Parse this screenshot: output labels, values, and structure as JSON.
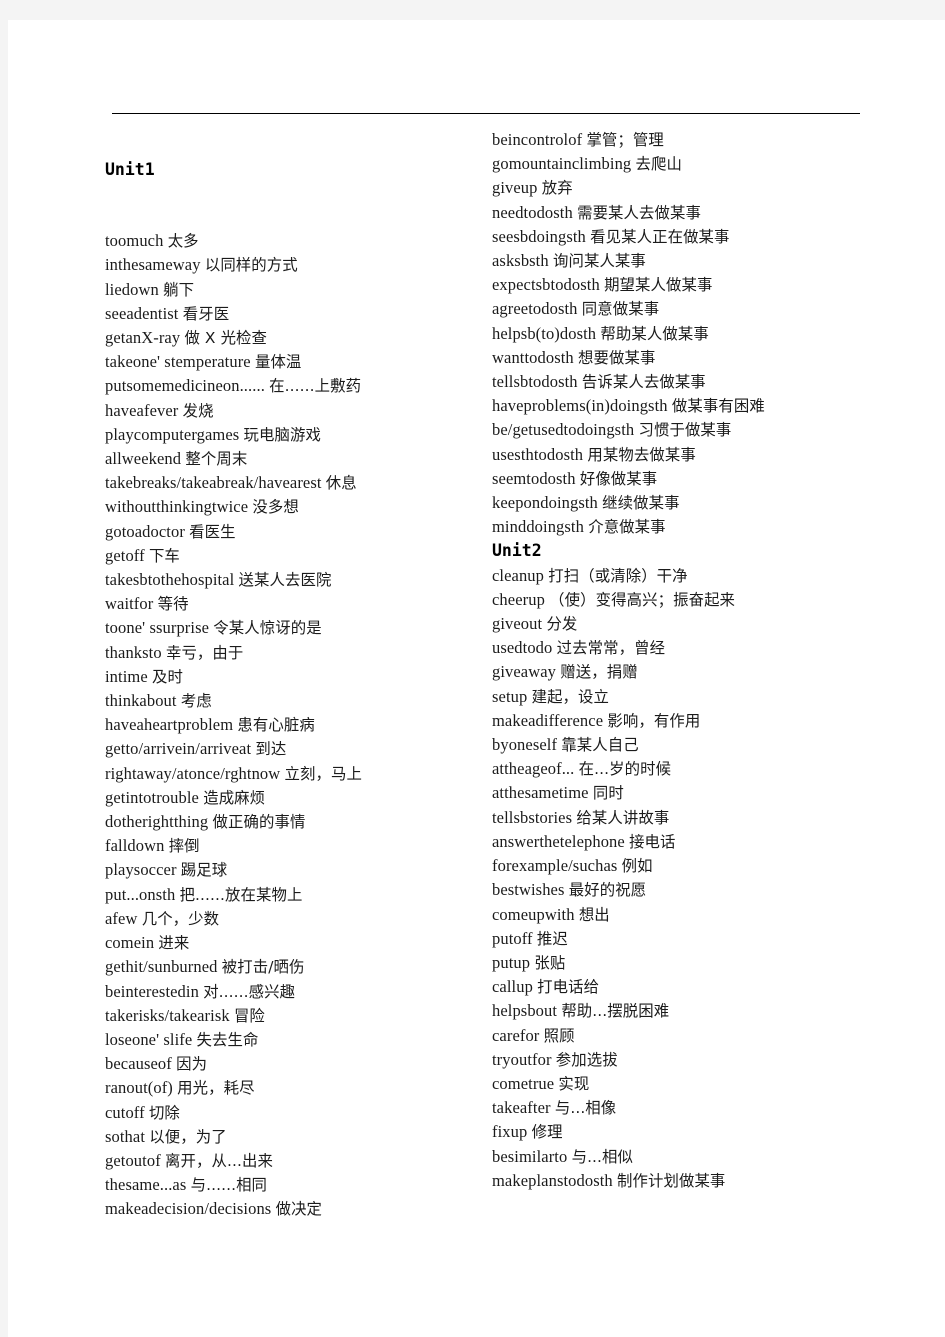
{
  "document": {
    "type": "vocabulary-list",
    "paper_color": "#ffffff",
    "background_color": "#f4f4f4",
    "rule_color": "#000000",
    "text_color": "#1b1b1b",
    "columns": 2
  },
  "left_column": {
    "heading": "Unit1",
    "entries": [
      {
        "en": "toomuch",
        "zh": "太多"
      },
      {
        "en": "inthesameway",
        "zh": "以同样的方式"
      },
      {
        "en": "liedown",
        "zh": "躺下"
      },
      {
        "en": "seeadentist",
        "zh": "看牙医"
      },
      {
        "en": "getanX-ray",
        "zh": "做 X 光检查"
      },
      {
        "en": "takeone' stemperature",
        "zh": "量体温"
      },
      {
        "en": "putsomemedicineon......",
        "zh": "在......上敷药"
      },
      {
        "en": "haveafever",
        "zh": "发烧"
      },
      {
        "en": "playcomputergames",
        "zh": "玩电脑游戏"
      },
      {
        "en": "allweekend",
        "zh": "整个周末"
      },
      {
        "en": "takebreaks/takeabreak/havearest",
        "zh": "休息"
      },
      {
        "en": "withoutthinkingtwice",
        "zh": "没多想"
      },
      {
        "en": "gotoadoctor",
        "zh": "看医生"
      },
      {
        "en": "getoff",
        "zh": "下车"
      },
      {
        "en": "takesbtothehospital",
        "zh": "送某人去医院"
      },
      {
        "en": "waitfor",
        "zh": "等待"
      },
      {
        "en": "toone' ssurprise",
        "zh": "令某人惊讶的是"
      },
      {
        "en": "thanksto",
        "zh": "幸亏，由于"
      },
      {
        "en": "intime",
        "zh": "及时"
      },
      {
        "en": "thinkabout",
        "zh": "考虑"
      },
      {
        "en": "haveaheartproblem",
        "zh": "患有心脏病"
      },
      {
        "en": "getto/arrivein/arriveat",
        "zh": "到达"
      },
      {
        "en": "rightaway/atonce/rghtnow",
        "zh": "立刻，马上"
      },
      {
        "en": "getintotrouble",
        "zh": "造成麻烦"
      },
      {
        "en": "dotherightthing",
        "zh": "做正确的事情"
      },
      {
        "en": "falldown",
        "zh": "摔倒"
      },
      {
        "en": "playsoccer",
        "zh": "踢足球"
      },
      {
        "en": "put...onsth",
        "zh": "把......放在某物上"
      },
      {
        "en": "afew",
        "zh": "几个，少数"
      },
      {
        "en": "comein",
        "zh": "进来"
      },
      {
        "en": "gethit/sunburned",
        "zh": "被打击/晒伤"
      },
      {
        "en": "beinterestedin",
        "zh": "对......感兴趣"
      },
      {
        "en": "takerisks/takearisk",
        "zh": "冒险"
      },
      {
        "en": "loseone' slife",
        "zh": "失去生命"
      },
      {
        "en": "becauseof",
        "zh": "因为"
      },
      {
        "en": "ranout(of)",
        "zh": "用光，耗尽"
      },
      {
        "en": "cutoff",
        "zh": "切除"
      },
      {
        "en": "sothat",
        "zh": "以便，为了"
      },
      {
        "en": "getoutof",
        "zh": "离开，从...出来"
      },
      {
        "en": "thesame...as",
        "zh": "与......相同"
      },
      {
        "en": "makeadecision/decisions",
        "zh": "做决定"
      }
    ]
  },
  "right_column": {
    "entries_before_unit2": [
      {
        "en": "beincontrolof",
        "zh": "掌管；管理"
      },
      {
        "en": "gomountainclimbing",
        "zh": "去爬山"
      },
      {
        "en": "giveup",
        "zh": "放弃"
      },
      {
        "en": "needtodosth",
        "zh": "需要某人去做某事"
      },
      {
        "en": "seesbdoingsth",
        "zh": "看见某人正在做某事"
      },
      {
        "en": "asksbsth",
        "zh": "询问某人某事"
      },
      {
        "en": "expectsbtodosth",
        "zh": "期望某人做某事"
      },
      {
        "en": "agreetodosth",
        "zh": "同意做某事"
      },
      {
        "en": "helpsb(to)dosth",
        "zh": "帮助某人做某事"
      },
      {
        "en": "wanttodosth",
        "zh": "想要做某事"
      },
      {
        "en": "tellsbtodosth",
        "zh": "告诉某人去做某事"
      },
      {
        "en": "haveproblems(in)doingsth",
        "zh": "做某事有困难"
      },
      {
        "en": "be/getusedtodoingsth",
        "zh": "习惯于做某事"
      },
      {
        "en": "usesthtodosth",
        "zh": "用某物去做某事"
      },
      {
        "en": "seemtodosth",
        "zh": "好像做某事"
      },
      {
        "en": "keepondoingsth",
        "zh": "继续做某事"
      },
      {
        "en": "minddoingsth",
        "zh": "介意做某事"
      }
    ],
    "heading": "Unit2",
    "entries_after_unit2": [
      {
        "en": "cleanup",
        "zh": "打扫（或清除）干净"
      },
      {
        "en": "cheerup",
        "zh": "（使）变得高兴；振奋起来"
      },
      {
        "en": "giveout",
        "zh": "分发"
      },
      {
        "en": "usedtodo",
        "zh": "过去常常，曾经"
      },
      {
        "en": "giveaway",
        "zh": "赠送，捐赠"
      },
      {
        "en": "setup",
        "zh": "建起，设立"
      },
      {
        "en": "makeadifference",
        "zh": "影响，有作用"
      },
      {
        "en": "byoneself",
        "zh": "靠某人自己"
      },
      {
        "en": "attheageof...",
        "zh": "在...岁的时候"
      },
      {
        "en": "atthesametime",
        "zh": "同时"
      },
      {
        "en": "tellsbstories",
        "zh": "给某人讲故事"
      },
      {
        "en": "answerthetelephone",
        "zh": "接电话"
      },
      {
        "en": "forexample/suchas",
        "zh": "例如"
      },
      {
        "en": "bestwishes",
        "zh": "最好的祝愿"
      },
      {
        "en": "comeupwith",
        "zh": "想出"
      },
      {
        "en": "putoff",
        "zh": "推迟"
      },
      {
        "en": "putup",
        "zh": "张贴"
      },
      {
        "en": "callup",
        "zh": "打电话给"
      },
      {
        "en": "helpsbout",
        "zh": "帮助...摆脱困难"
      },
      {
        "en": "carefor",
        "zh": "照顾"
      },
      {
        "en": "tryoutfor",
        "zh": "参加选拔"
      },
      {
        "en": "cometrue",
        "zh": "实现"
      },
      {
        "en": "takeafter",
        "zh": "与...相像"
      },
      {
        "en": "fixup",
        "zh": "修理"
      },
      {
        "en": "besimilarto",
        "zh": "与...相似"
      },
      {
        "en": "makeplanstodosth",
        "zh": "制作计划做某事"
      }
    ]
  }
}
